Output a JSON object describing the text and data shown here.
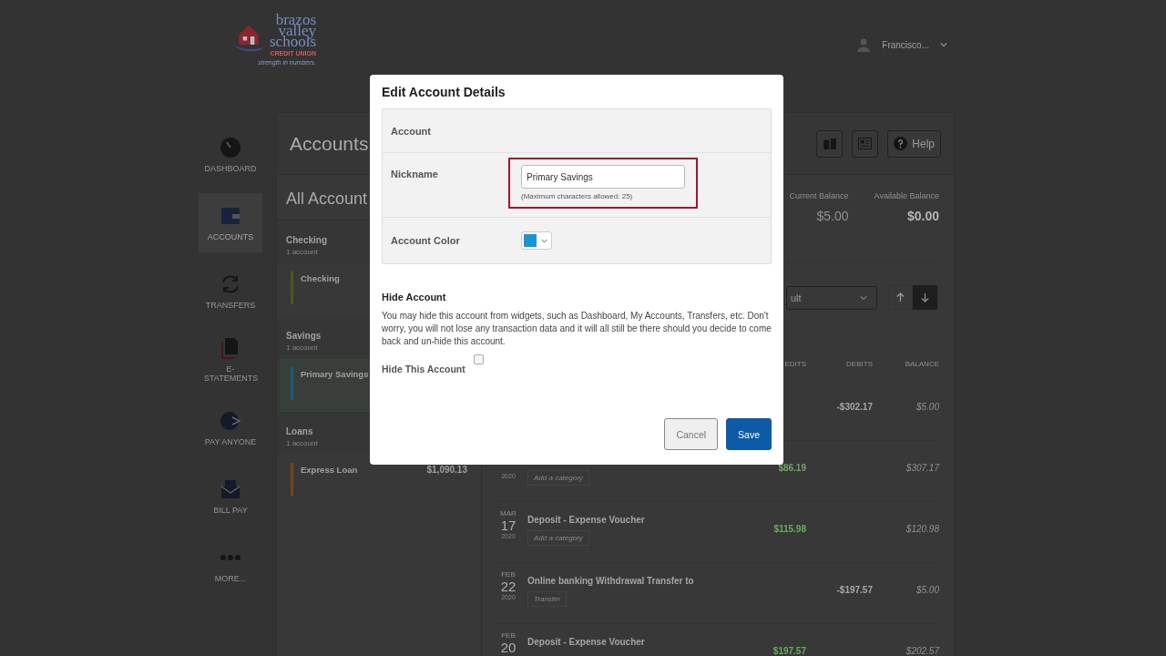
{
  "header": {
    "logo": {
      "lines": [
        "brazos",
        "valley",
        "schools"
      ],
      "subtitle": "CREDIT UNION",
      "tagline": "strength in numbers."
    },
    "user": {
      "name": "Francisco..."
    }
  },
  "nav": [
    {
      "kind": "gauge",
      "label": "DASHBOARD",
      "selected": false
    },
    {
      "kind": "wallet",
      "label": "ACCOUNTS",
      "selected": true
    },
    {
      "kind": "transfer",
      "label": "TRANSFERS",
      "selected": false
    },
    {
      "kind": "document",
      "label": "E-STATEMENTS",
      "selected": false
    },
    {
      "kind": "pay",
      "label": "PAY ANYONE",
      "selected": false
    },
    {
      "kind": "bill",
      "label": "BILL PAY",
      "selected": false
    },
    {
      "kind": "more",
      "label": "MORE...",
      "selected": false
    }
  ],
  "page": {
    "title": "Accounts",
    "toolbar": [
      {
        "kind": "columns"
      },
      {
        "kind": "list"
      },
      {
        "kind": "help",
        "label": "Help"
      }
    ]
  },
  "accounts": {
    "title": "All Account",
    "groups": [
      {
        "name": "Checking",
        "count": "1 account",
        "items": [
          {
            "name": "Checking",
            "color": "#4a5a1a",
            "selected": false
          }
        ]
      },
      {
        "name": "Savings",
        "count": "1 account",
        "items": [
          {
            "name": "Primary Savings",
            "color": "#1a5a80",
            "selected": true
          }
        ]
      },
      {
        "name": "Loans",
        "count": "1 account",
        "items": [
          {
            "name": "Express Loan",
            "amount": "$1,090.13",
            "color": "#7a4510",
            "selected": false
          }
        ]
      }
    ]
  },
  "balances": [
    {
      "label": "Current Balance",
      "value": "$5.00",
      "emphasis": false
    },
    {
      "label": "Available Balance",
      "value": "$0.00",
      "emphasis": true
    }
  ],
  "sort": {
    "value": "ult",
    "directions": [
      {
        "kind": "up",
        "selected": false
      },
      {
        "kind": "down",
        "selected": true
      }
    ]
  },
  "transactions": {
    "columns": [
      "EDITS",
      "DEBITS",
      "BALANCE"
    ],
    "rows": [
      {
        "debit": "-$302.17",
        "balance": "$5.00"
      },
      {
        "year": "2020",
        "category": "Add a category",
        "credit": "$86.19",
        "balance": "$307.17"
      },
      {
        "month": "MAR",
        "day": "17",
        "year": "2020",
        "description": "Deposit - Expense Voucher",
        "category": "Add a category",
        "credit": "$115.98",
        "balance": "$120.98"
      },
      {
        "month": "FEB",
        "day": "22",
        "year": "2020",
        "description": "Online banking Withdrawal Transfer to",
        "category": "Transfer",
        "debit": "-$197.57",
        "balance": "$5.00"
      },
      {
        "month": "FEB",
        "day": "20",
        "description": "Deposit - Expense Voucher",
        "credit": "$197.57",
        "balance": "$202.57"
      }
    ]
  },
  "modal": {
    "title": "Edit Account Details",
    "fields": [
      {
        "kind": "text",
        "label": "Account"
      },
      {
        "kind": "input",
        "label": "Nickname",
        "value": "Primary Savings",
        "hint": "(Maximum characters allowed: 25)",
        "highlighted": true
      },
      {
        "kind": "color",
        "label": "Account Color",
        "color": "#1b94d2"
      }
    ],
    "hide_title": "Hide Account",
    "hide_text": "You may hide this account from widgets, such as Dashboard, My Accounts, Transfers, etc. Don't worry, you will not lose any transaction data and it will all still be there should you decide to come back and un-hide this account.",
    "hide_label": "Hide This Account",
    "hide_checked": false,
    "buttons": [
      {
        "kind": "secondary",
        "label": "Cancel"
      },
      {
        "kind": "primary",
        "label": "Save"
      }
    ]
  }
}
